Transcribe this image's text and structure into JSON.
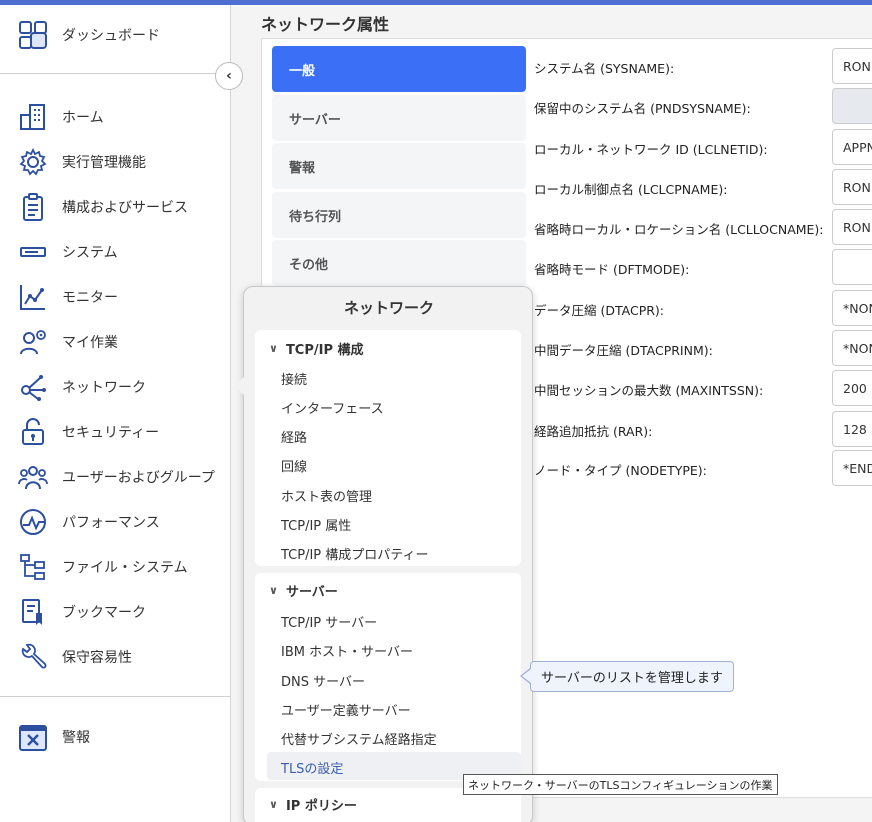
{
  "sidebar": {
    "dashboard": "ダッシュボード",
    "items": [
      {
        "label": "ホーム",
        "icon": "building-icon"
      },
      {
        "label": "実行管理機能",
        "icon": "gear-icon"
      },
      {
        "label": "構成およびサービス",
        "icon": "clipboard-icon"
      },
      {
        "label": "システム",
        "icon": "server-icon"
      },
      {
        "label": "モニター",
        "icon": "chart-line-icon"
      },
      {
        "label": "マイ作業",
        "icon": "user-gear-icon"
      },
      {
        "label": "ネットワーク",
        "icon": "network-icon"
      },
      {
        "label": "セキュリティー",
        "icon": "lock-icon"
      },
      {
        "label": "ユーザーおよびグループ",
        "icon": "users-icon"
      },
      {
        "label": "パフォーマンス",
        "icon": "performance-icon"
      },
      {
        "label": "ファイル・システム",
        "icon": "file-tree-icon"
      },
      {
        "label": "ブックマーク",
        "icon": "bookmark-icon"
      },
      {
        "label": "保守容易性",
        "icon": "wrench-icon"
      }
    ],
    "alerts": "警報"
  },
  "main": {
    "title": "ネットワーク属性",
    "tabs": [
      "一般",
      "サーバー",
      "警報",
      "待ち行列",
      "その他"
    ],
    "fields": [
      {
        "label": "システム名 (SYSNAME):",
        "value": "RON"
      },
      {
        "label": "保留中のシステム名 (PNDSYSNAME):",
        "value": ""
      },
      {
        "label": "ローカル・ネットワーク ID (LCLNETID):",
        "value": "APPN"
      },
      {
        "label": "ローカル制御点名 (LCLCPNAME):",
        "value": "RON"
      },
      {
        "label": "省略時ローカル・ロケーション名 (LCLLOCNAME):",
        "value": "RON"
      },
      {
        "label": "省略時モード (DFTMODE):",
        "value": ""
      },
      {
        "label": "データ圧縮 (DTACPR):",
        "value": "*NON"
      },
      {
        "label": "中間データ圧縮 (DTACPRINM):",
        "value": "*NON"
      },
      {
        "label": "中間セッションの最大数 (MAXINTSSN):",
        "value": "200"
      },
      {
        "label": "経路追加抵抗 (RAR):",
        "value": "128"
      },
      {
        "label": "ノード・タイプ (NODETYPE):",
        "value": "*END"
      }
    ]
  },
  "flyout": {
    "title": "ネットワーク",
    "groups": [
      {
        "heading": "TCP/IP 構成",
        "items": [
          "接続",
          "インターフェース",
          "経路",
          "回線",
          "ホスト表の管理",
          "TCP/IP 属性",
          "TCP/IP 構成プロパティー"
        ]
      },
      {
        "heading": "サーバー",
        "items": [
          "TCP/IP サーバー",
          "IBM ホスト・サーバー",
          "DNS サーバー",
          "ユーザー定義サーバー",
          "代替サブシステム経路指定",
          "TLSの設定"
        ]
      },
      {
        "heading": "IP ポリシー",
        "items": []
      }
    ]
  },
  "tooltip": "サーバーのリストを管理します",
  "hover_tip": "ネットワーク・サーバーのTLSコンフィギュレーションの作業",
  "colors": {
    "accent": "#3b6ff5",
    "topbar": "#4d6fd1"
  }
}
